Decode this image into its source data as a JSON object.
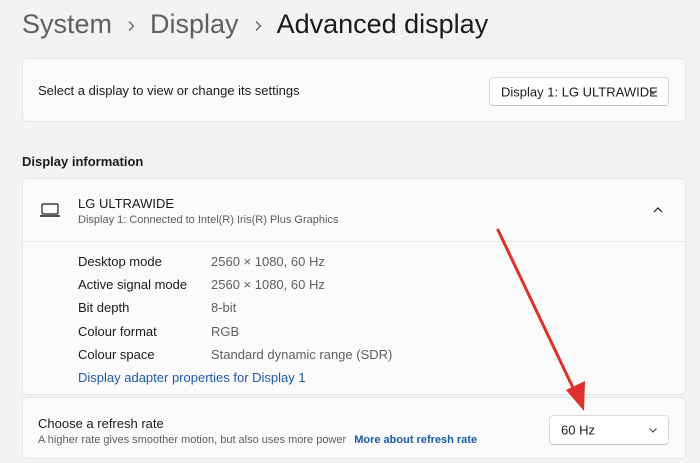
{
  "breadcrumb": {
    "items": [
      "System",
      "Display",
      "Advanced display"
    ]
  },
  "select_display": {
    "label": "Select a display to view or change its settings",
    "dropdown_value": "Display 1: LG ULTRAWIDE"
  },
  "display_info": {
    "heading": "Display information",
    "name": "LG ULTRAWIDE",
    "subtitle": "Display 1: Connected to Intel(R) Iris(R) Plus Graphics",
    "rows": [
      {
        "label": "Desktop mode",
        "value": "2560 × 1080, 60 Hz"
      },
      {
        "label": "Active signal mode",
        "value": "2560 × 1080, 60 Hz"
      },
      {
        "label": "Bit depth",
        "value": "8-bit"
      },
      {
        "label": "Colour format",
        "value": "RGB"
      },
      {
        "label": "Colour space",
        "value": "Standard dynamic range (SDR)"
      }
    ],
    "adapter_link": "Display adapter properties for Display 1"
  },
  "refresh_rate": {
    "title": "Choose a refresh rate",
    "description": "A higher rate gives smoother motion, but also uses more power",
    "more_link": "More about refresh rate",
    "dropdown_value": "60 Hz"
  },
  "icons": {
    "chevron_right": "chevron-right-icon",
    "chevron_down": "chevron-down-icon",
    "chevron_up": "chevron-up-icon",
    "laptop": "laptop-icon",
    "annotation_arrow": "red-arrow"
  },
  "colors": {
    "link": "#1f5aa6",
    "annotation": "#e0302b",
    "background": "#f3f3f3",
    "card": "#fbfbfb"
  }
}
